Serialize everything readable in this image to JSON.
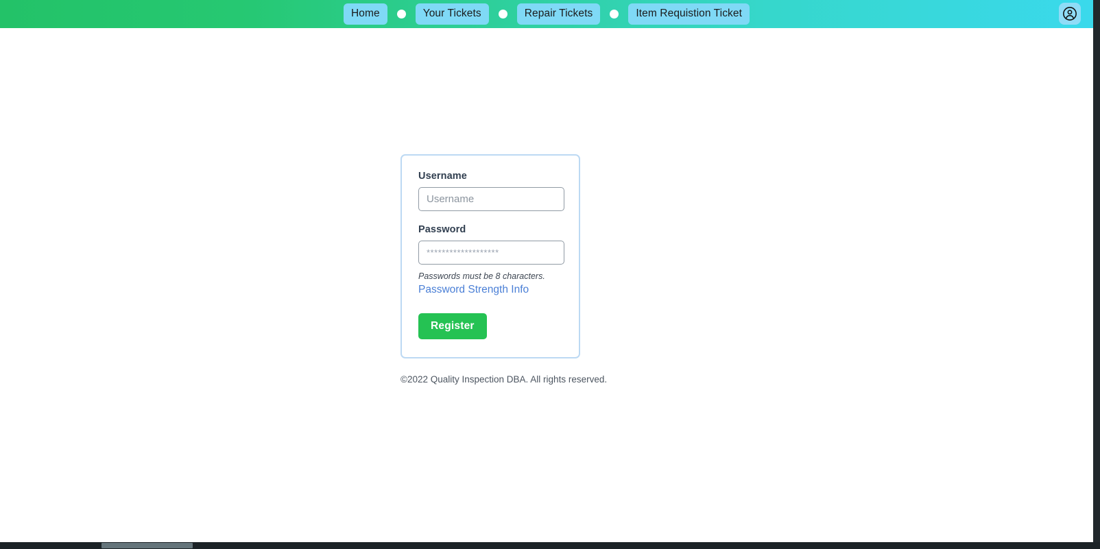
{
  "navbar": {
    "items": [
      {
        "label": "Home",
        "name": "nav-home"
      },
      {
        "label": "Your Tickets",
        "name": "nav-your-tickets"
      },
      {
        "label": "Repair Tickets",
        "name": "nav-repair-tickets"
      },
      {
        "label": "Item Requistion Ticket",
        "name": "nav-item-requistion-ticket"
      }
    ],
    "account_icon": "account-circle-icon",
    "gradient_start": "#23c268",
    "gradient_end": "#3ad9ec",
    "pill_color": "#7fd9f6",
    "separator_icon": "dot-separator-icon"
  },
  "form": {
    "username_label": "Username",
    "username_value": "",
    "username_placeholder": "Username",
    "password_label": "Password",
    "password_value": "",
    "password_placeholder": "*******************",
    "password_hint": "Passwords must be 8 characters.",
    "strength_link": "Password Strength Info",
    "strength_link_color": "#4a7fd6",
    "register_button": "Register",
    "register_button_color": "#25c253",
    "card_border_color": "#bcd9f3"
  },
  "footer": {
    "copyright": "©2022 Quality Inspection DBA. All rights reserved."
  }
}
